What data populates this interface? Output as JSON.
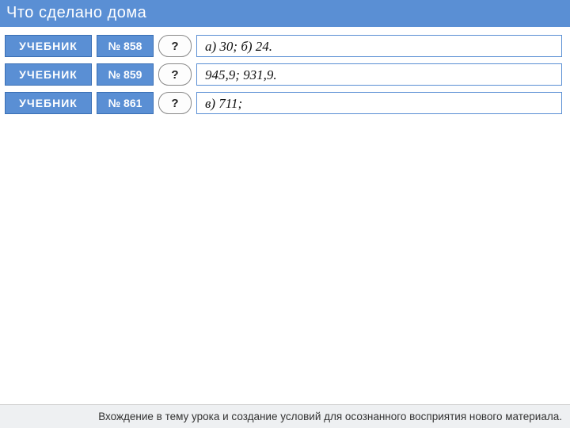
{
  "header": {
    "title": "Что  сделано  дома"
  },
  "rows": [
    {
      "tag": "УЧЕБНИК",
      "num": "№ 858",
      "q": "?",
      "answer": "а) 30;  б) 24."
    },
    {
      "tag": "УЧЕБНИК",
      "num": "№ 859",
      "q": "?",
      "answer": "945,9; 931,9."
    },
    {
      "tag": "УЧЕБНИК",
      "num": "№ 861",
      "q": "?",
      "answer": "в) 711;"
    }
  ],
  "footer": {
    "text": "Вхождение в тему урока и создание условий для осознанного восприятия нового материала."
  }
}
